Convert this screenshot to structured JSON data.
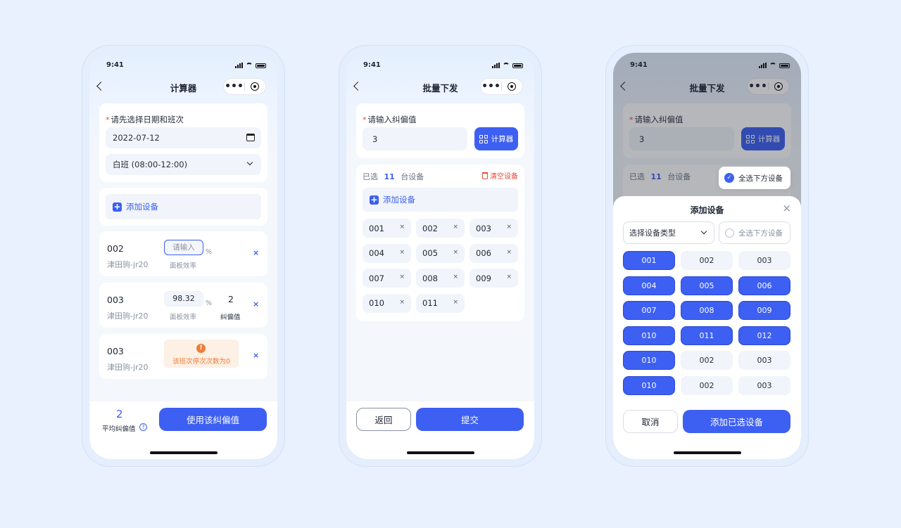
{
  "status": {
    "time": "9:41"
  },
  "phone1": {
    "title": "计算器",
    "date_label": "请先选择日期和班次",
    "date_value": "2022-07-12",
    "shift_value": "白班 (08:00-12:00)",
    "add_device": "添加设备",
    "devices": [
      {
        "code": "002",
        "name": "津田驹-jr20",
        "input_placeholder": "请输入",
        "unit": "%",
        "eff_label": "面板效率"
      },
      {
        "code": "003",
        "name": "津田驹-jr20",
        "eff_value": "98.32",
        "unit": "%",
        "eff_label": "面板效率",
        "dev_value": "2",
        "dev_label": "纠偏值"
      },
      {
        "code": "003",
        "name": "津田驹-jr20",
        "warning": "该班次停次次数为0"
      }
    ],
    "avg_value": "2",
    "avg_label": "平均纠偏值",
    "help": "?",
    "use_button": "使用该纠偏值"
  },
  "phone2": {
    "title": "批量下发",
    "input_label": "请输入纠偏值",
    "input_value": "3",
    "calc_button": "计算器",
    "selected_prefix": "已选",
    "selected_count": "11",
    "selected_suffix": "台设备",
    "clear_button": "清空设备",
    "add_device": "添加设备",
    "chips": [
      "001",
      "002",
      "003",
      "004",
      "005",
      "006",
      "007",
      "008",
      "009",
      "010",
      "011"
    ],
    "chip_close": "×",
    "back_button": "返回",
    "submit_button": "提交"
  },
  "phone3": {
    "title": "批量下发",
    "input_label": "请输入纠偏值",
    "input_value": "3",
    "calc_button": "计算器",
    "selected_prefix": "已选",
    "selected_count": "11",
    "selected_suffix": "台设备",
    "select_all_below": "全选下方设备",
    "sheet_title": "添加设备",
    "type_select": "选择设备类型",
    "select_all": "全选下方设备",
    "grid": [
      {
        "label": "001",
        "on": true
      },
      {
        "label": "002",
        "on": false
      },
      {
        "label": "003",
        "on": false
      },
      {
        "label": "004",
        "on": true
      },
      {
        "label": "005",
        "on": true
      },
      {
        "label": "006",
        "on": true
      },
      {
        "label": "007",
        "on": true
      },
      {
        "label": "008",
        "on": true
      },
      {
        "label": "009",
        "on": true
      },
      {
        "label": "010",
        "on": true
      },
      {
        "label": "011",
        "on": true
      },
      {
        "label": "012",
        "on": true
      },
      {
        "label": "010",
        "on": true
      },
      {
        "label": "002",
        "on": false
      },
      {
        "label": "003",
        "on": false
      },
      {
        "label": "010",
        "on": true
      },
      {
        "label": "002",
        "on": false
      },
      {
        "label": "003",
        "on": false
      }
    ],
    "cancel_button": "取消",
    "add_selected_button": "添加已选设备"
  }
}
